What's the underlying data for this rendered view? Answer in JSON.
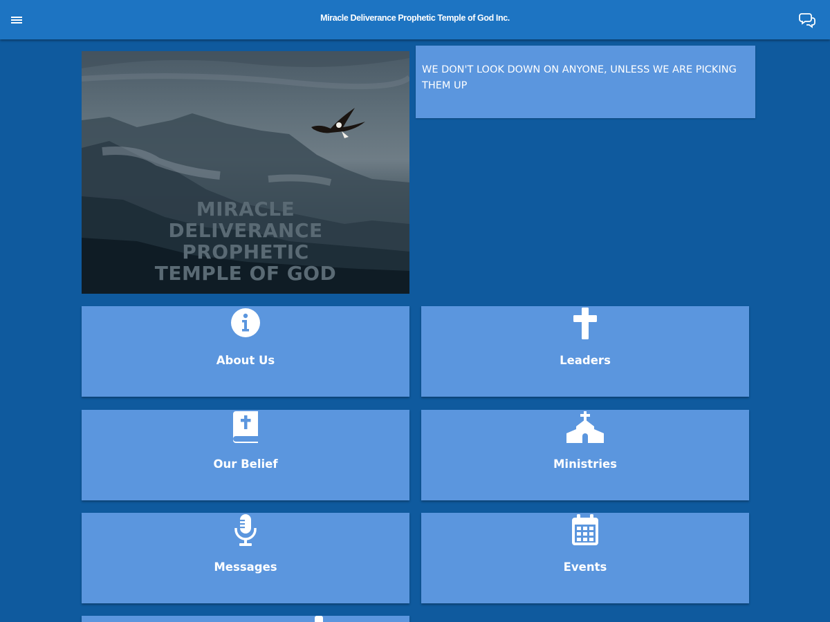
{
  "header": {
    "title": "Miracle Deliverance Prophetic Temple of God Inc.",
    "menu_icon": "hamburger-menu-icon",
    "chat_icon": "chat-bubbles-icon"
  },
  "hero": {
    "text_lines": [
      "MIRACLE",
      "DELIVERANCE",
      "PROPHETIC",
      "TEMPLE OF GOD"
    ]
  },
  "quote": {
    "text": "WE DON'T LOOK DOWN ON ANYONE, UNLESS WE ARE PICKING THEM UP"
  },
  "tiles": [
    {
      "label": "About Us",
      "icon": "info-icon"
    },
    {
      "label": "Leaders",
      "icon": "cross-icon"
    },
    {
      "label": "Our Belief",
      "icon": "bible-icon"
    },
    {
      "label": "Ministries",
      "icon": "church-icon"
    },
    {
      "label": "Messages",
      "icon": "microphone-icon"
    },
    {
      "label": "Events",
      "icon": "calendar-icon"
    }
  ],
  "colors": {
    "background": "#0f5a9e",
    "header": "#1d74c2",
    "tile": "#5b96de",
    "text": "#ffffff"
  }
}
